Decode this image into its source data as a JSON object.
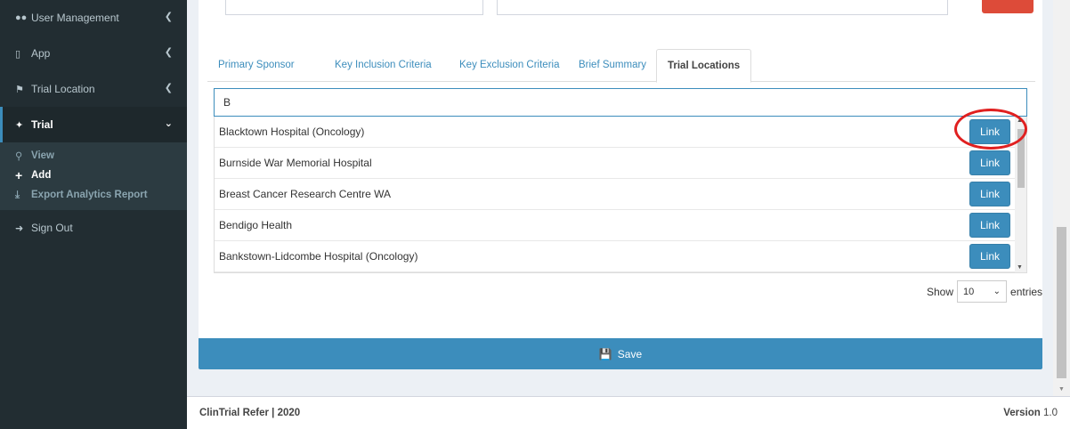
{
  "sidebar": {
    "items": [
      {
        "label": "User Management",
        "icon": "users-icon"
      },
      {
        "label": "App",
        "icon": "mobile-icon"
      },
      {
        "label": "Trial Location",
        "icon": "location-icon"
      },
      {
        "label": "Trial",
        "icon": "magic-wand-icon"
      }
    ],
    "submenu": [
      {
        "label": "View",
        "icon": "search-icon"
      },
      {
        "label": "Add",
        "icon": "plus-icon"
      },
      {
        "label": "Export Analytics Report",
        "icon": "download-icon"
      }
    ],
    "sign_out": "Sign Out"
  },
  "tabs": [
    {
      "label": "Primary Sponsor"
    },
    {
      "label": "Key Inclusion Criteria"
    },
    {
      "label": "Key Exclusion Criteria"
    },
    {
      "label": "Brief Summary"
    },
    {
      "label": "Trial Locations"
    }
  ],
  "search": {
    "value": "B"
  },
  "locations": [
    {
      "name": "Blacktown Hospital (Oncology)",
      "button": "Link"
    },
    {
      "name": "Burnside War Memorial Hospital",
      "button": "Link"
    },
    {
      "name": "Breast Cancer Research Centre WA",
      "button": "Link"
    },
    {
      "name": "Bendigo Health",
      "button": "Link"
    },
    {
      "name": "Bankstown-Lidcombe Hospital (Oncology)",
      "button": "Link"
    }
  ],
  "entries": {
    "show": "Show",
    "value": "10",
    "suffix": "entries"
  },
  "save_label": "Save",
  "footer": {
    "left": "ClinTrial Refer | 2020",
    "version_label": "Version",
    "version": "1.0"
  },
  "colors": {
    "primary": "#3c8dbc",
    "sidebar": "#222d32",
    "highlight_ring": "#e02020",
    "danger": "#dd4b39"
  }
}
